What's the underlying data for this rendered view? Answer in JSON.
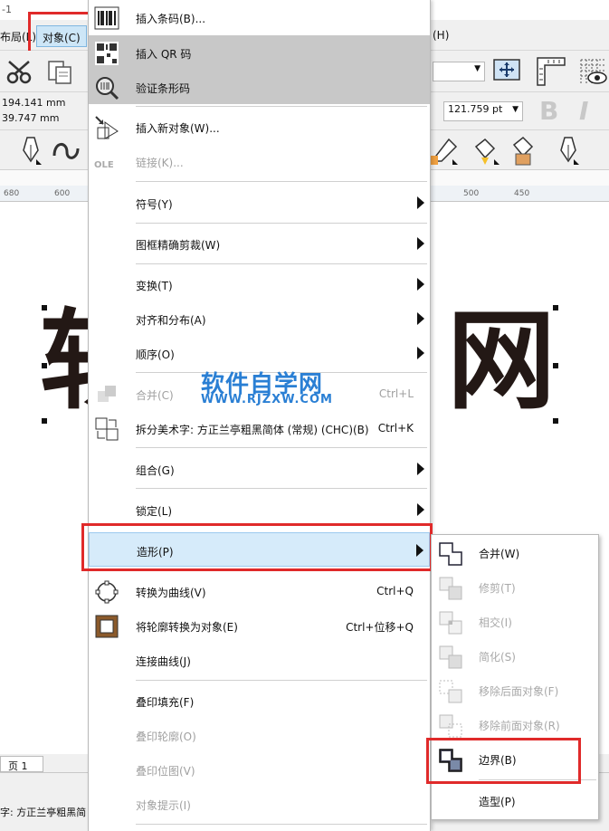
{
  "window": {
    "title_fragment": "-1"
  },
  "menubar": {
    "layout": "布局(L)",
    "object": "对象(C)",
    "help": "(H)"
  },
  "props": {
    "x_value": "194.141 mm",
    "y_value": "39.747 mm",
    "font_size": "121.759 pt"
  },
  "ruler": {
    "t680": "680",
    "t600": "600",
    "t500": "500",
    "t450": "450"
  },
  "canvas": {
    "char_left": "软",
    "char_right": "网"
  },
  "watermark": {
    "line1": "软件自学网",
    "line2": "WWW.RJZXW.COM"
  },
  "object_menu": {
    "insert_barcode": "插入条码(B)...",
    "insert_qr": "插入 QR 码",
    "verify_barcode": "验证条形码",
    "insert_new_object": "插入新对象(W)...",
    "links": "链接(K)...",
    "ole": "OLE",
    "symbol": "符号(Y)",
    "powerclip": "图框精确剪裁(W)",
    "transform": "变换(T)",
    "align": "对齐和分布(A)",
    "order": "顺序(O)",
    "combine": "合并(C)",
    "combine_shortcut": "Ctrl+L",
    "break_apart": "拆分美术字: 方正兰亭粗黑简体 (常规) (CHC)(B)",
    "break_apart_shortcut": "Ctrl+K",
    "group": "组合(G)",
    "lock": "锁定(L)",
    "shaping": "造形(P)",
    "convert_to_curves": "转换为曲线(V)",
    "convert_to_curves_shortcut": "Ctrl+Q",
    "convert_outline": "将轮廓转换为对象(E)",
    "convert_outline_shortcut": "Ctrl+位移+Q",
    "connect_curves": "连接曲线(J)",
    "overprint_fill": "叠印填充(F)",
    "overprint_outline": "叠印轮廓(O)",
    "overprint_bitmap": "叠印位图(V)",
    "object_hints": "对象提示(I)"
  },
  "shaping_submenu": {
    "weld": "合并(W)",
    "trim": "修剪(T)",
    "intersect": "相交(I)",
    "simplify": "简化(S)",
    "back_minus_front": "移除后面对象(F)",
    "front_minus_back": "移除前面对象(R)",
    "boundary": "边界(B)",
    "shaping": "造型(P)"
  },
  "status": {
    "page_tab": "页 1",
    "font_info": "字: 方正兰亭粗黑简"
  },
  "colors": {
    "highlight_blue": "#d6ebfa",
    "red_outline": "#e02a2a",
    "watermark": "#2a7fd4"
  }
}
